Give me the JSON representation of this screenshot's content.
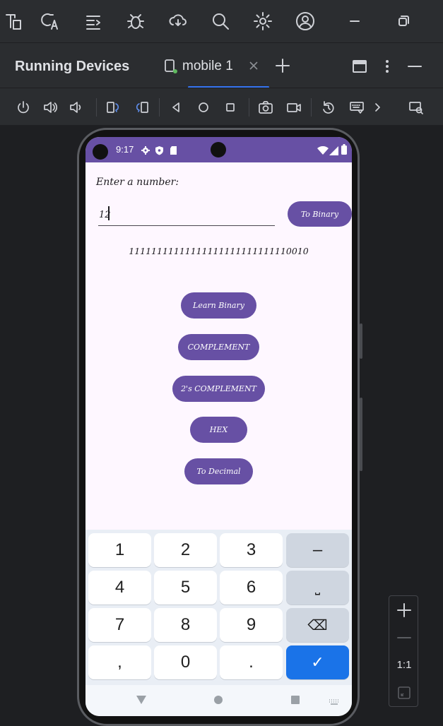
{
  "top_toolbar": {
    "icons": [
      "project-icon",
      "translate-icon",
      "structure-icon",
      "debug-icon",
      "cloud-sync-icon",
      "search-icon",
      "gear-icon",
      "profile-icon",
      "minimize-window-icon",
      "restore-window-icon"
    ]
  },
  "panel": {
    "title": "Running Devices",
    "tab_label": "mobile 1"
  },
  "device_toolbar": {
    "icons": [
      "power-icon",
      "volume-up-icon",
      "volume-down-icon",
      "rotate-left-icon",
      "rotate-right-icon",
      "back-icon",
      "home-icon",
      "overview-icon",
      "screenshot-icon",
      "screen-record-icon",
      "reset-icon",
      "keyboard-icon",
      "more-chevron-icon",
      "device-mirror-icon"
    ]
  },
  "phone": {
    "status_time": "9:17",
    "app": {
      "prompt": "Enter a number:",
      "input_value": "12",
      "to_binary_label": "To Binary",
      "result": "11111111111111111111111111110010",
      "buttons": {
        "learn_binary": "Learn Binary",
        "complement": "COMPLEMENT",
        "twos_complement": "2's COMPLEMENT",
        "hex": "HEX",
        "to_decimal": "To Decimal"
      }
    },
    "keyboard": {
      "rows": [
        [
          "1",
          "2",
          "3",
          "–"
        ],
        [
          "4",
          "5",
          "6",
          "⎵"
        ],
        [
          "7",
          "8",
          "9",
          "⌫"
        ],
        [
          ",",
          "0",
          ".",
          "✓"
        ]
      ]
    }
  },
  "zoom": {
    "ratio_label": "1:1"
  },
  "colors": {
    "accent": "#6750a4",
    "ide_bg": "#2b2d30",
    "tab_accent": "#3574f0",
    "keyboard_done": "#1a73e8"
  }
}
